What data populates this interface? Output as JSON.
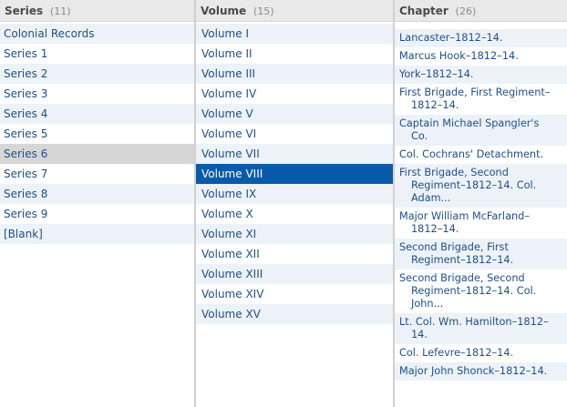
{
  "series": {
    "title": "Series",
    "count": "(11)",
    "items": [
      "Colonial Records",
      "Series 1",
      "Series 2",
      "Series 3",
      "Series 4",
      "Series 5",
      "Series 6",
      "Series 7",
      "Series 8",
      "Series 9",
      "[Blank]"
    ],
    "highlighted": "Series 6"
  },
  "volume": {
    "title": "Volume",
    "count": "(15)",
    "items": [
      "Volume I",
      "Volume II",
      "Volume III",
      "Volume IV",
      "Volume V",
      "Volume VI",
      "Volume VII",
      "Volume VIII",
      "Volume IX",
      "Volume X",
      "Volume XI",
      "Volume XII",
      "Volume XIII",
      "Volume XIV",
      "Volume XV"
    ],
    "selected": "Volume VIII"
  },
  "chapter": {
    "title": "Chapter",
    "count": "(26)",
    "items": [
      [
        "Lancaster–1812–14."
      ],
      [
        "Marcus Hook–1812–14."
      ],
      [
        "York–1812–14."
      ],
      [
        "First Brigade, First Regiment–",
        "1812–14."
      ],
      [
        "Captain Michael Spangler's",
        "Co."
      ],
      [
        "Col. Cochrans' Detachment."
      ],
      [
        "First Brigade, Second",
        "Regiment–1812–14. Col.",
        "Adam..."
      ],
      [
        "Major William McFarland–",
        "1812–14."
      ],
      [
        "Second Brigade, First",
        "Regiment–1812–14."
      ],
      [
        "Second Brigade, Second",
        "Regiment–1812–14. Col.",
        "John..."
      ],
      [
        "Lt. Col. Wm. Hamilton–1812–",
        "14."
      ],
      [
        "Col. Lefevre–1812–14."
      ],
      [
        "Major John Shonck–1812–14."
      ]
    ]
  }
}
